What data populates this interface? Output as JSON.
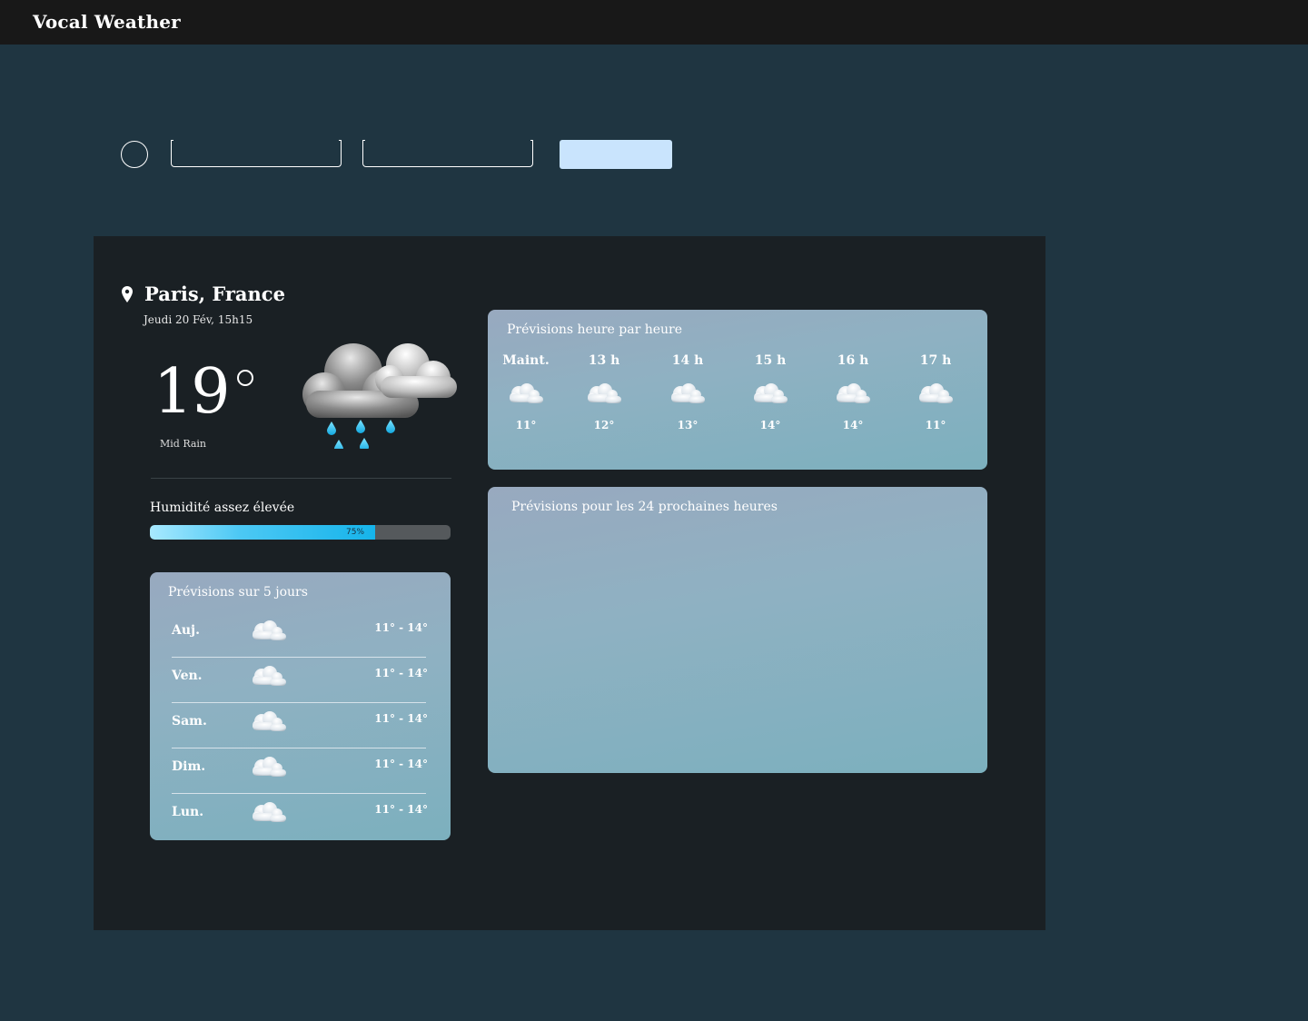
{
  "app": {
    "title": "Vocal Weather"
  },
  "location": {
    "city": "Paris, France",
    "datetime": "Jeudi 20 Fév, 15h15"
  },
  "current": {
    "temperature": "19",
    "condition": "Mid Rain",
    "icon": "cloud-rain-icon"
  },
  "humidity": {
    "label": "Humidité assez élevée",
    "percent_text": "75%",
    "value": 0.75
  },
  "five_day": {
    "title": "Prévisions sur 5 jours",
    "days": [
      {
        "name": "Auj.",
        "range": "11° - 14°",
        "icon": "cloud-icon"
      },
      {
        "name": "Ven.",
        "range": "11° - 14°",
        "icon": "cloud-icon"
      },
      {
        "name": "Sam.",
        "range": "11° - 14°",
        "icon": "cloud-icon"
      },
      {
        "name": "Dim.",
        "range": "11° - 14°",
        "icon": "cloud-icon"
      },
      {
        "name": "Lun.",
        "range": "11° - 14°",
        "icon": "cloud-icon"
      }
    ]
  },
  "hourly": {
    "title": "Prévisions heure par heure",
    "hours": [
      {
        "label": "Maint.",
        "temp": "11°",
        "icon": "cloud-icon"
      },
      {
        "label": "13 h",
        "temp": "12°",
        "icon": "cloud-icon"
      },
      {
        "label": "14 h",
        "temp": "13°",
        "icon": "cloud-icon"
      },
      {
        "label": "15 h",
        "temp": "14°",
        "icon": "cloud-icon"
      },
      {
        "label": "16 h",
        "temp": "14°",
        "icon": "cloud-icon"
      },
      {
        "label": "17 h",
        "temp": "11°",
        "icon": "cloud-icon"
      }
    ]
  },
  "next24": {
    "title": "Prévisions pour les 24 prochaines heures"
  },
  "colors": {
    "background": "#1f3541",
    "topbar": "#181818",
    "panel": "#1a2024",
    "button": "#c9e4fd",
    "humidity_fill": "#16b4ea"
  }
}
